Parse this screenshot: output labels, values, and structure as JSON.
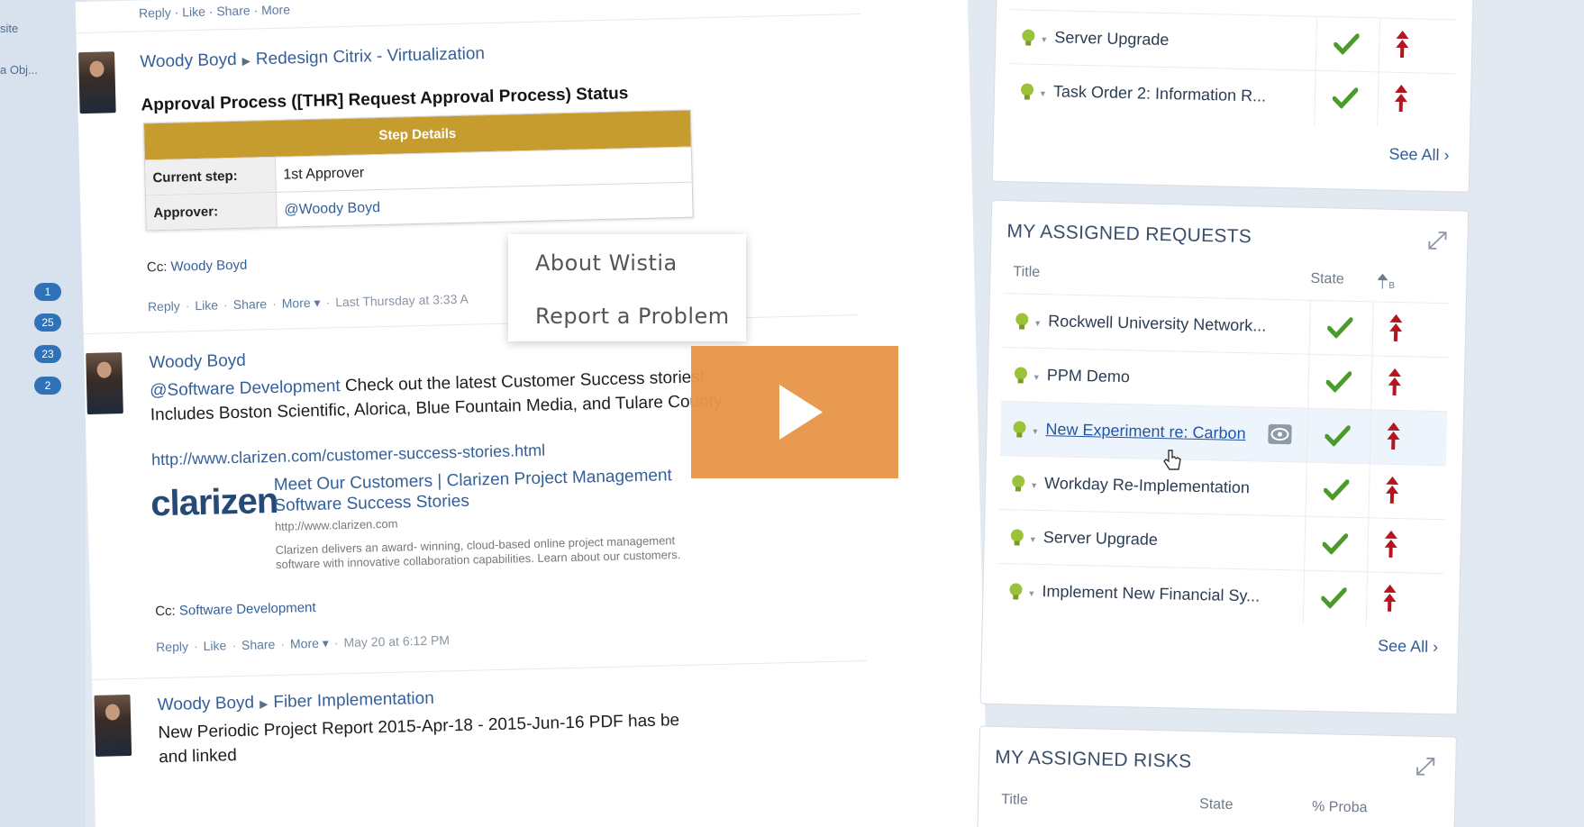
{
  "left_nav": {
    "items": [
      "site",
      "a Obj..."
    ],
    "badges": [
      "1",
      "25",
      "23",
      "2"
    ]
  },
  "feed": {
    "top_actions": "Reply · Like · Share · More",
    "post1": {
      "author": "Woody Boyd",
      "target": "Redesign Citrix - Virtualization",
      "approval_title": "Approval Process ([THR] Request Approval Process) Status",
      "step_details": "Step Details",
      "current_step_label": "Current step:",
      "current_step_value": "1st Approver",
      "approver_label": "Approver:",
      "approver_value": "@Woody Boyd",
      "cc_label": "Cc:",
      "cc_value": "Woody Boyd",
      "actions": {
        "reply": "Reply",
        "like": "Like",
        "share": "Share",
        "more": "More ▾",
        "timestamp": "Last Thursday at 3:33 A"
      }
    },
    "post2": {
      "author": "Woody Boyd",
      "mention": "@Software Development",
      "text1": "Check out the latest Customer Success stories!",
      "text2": "Includes Boston Scientific, Alorica, Blue Fountain Media, and Tulare County.",
      "link": "http://www.clarizen.com/customer-success-stories.html",
      "logo": "clarizen",
      "preview_title": "Meet Our Customers | Clarizen Project Management Software Success Stories",
      "preview_url": "http://www.clarizen.com",
      "preview_desc": "Clarizen delivers an award- winning, cloud-based online project management software with innovative collaboration capabilities. Learn about our customers.",
      "cc_label": "Cc:",
      "cc_value": "Software Development",
      "actions": {
        "reply": "Reply",
        "like": "Like",
        "share": "Share",
        "more": "More ▾",
        "timestamp": "May 20 at 6:12 PM"
      }
    },
    "post3": {
      "author": "Woody Boyd",
      "target": "Fiber Implementation",
      "text1": "New Periodic Project Report 2015-Apr-18 - 2015-Jun-16 PDF has be",
      "text2": "and linked"
    }
  },
  "sidebar": {
    "top_widget": {
      "rows": [
        "Server Upgrade",
        "Task Order 2: Information R..."
      ],
      "see_all": "See All ›"
    },
    "assigned_requests": {
      "title": "MY ASSIGNED REQUESTS",
      "col_title": "Title",
      "col_state": "State",
      "col_priority_icon": "priority-sort-icon",
      "rows": [
        "Rockwell University Network...",
        "PPM Demo",
        "New Experiment re: Carbon",
        "Workday Re-Implementation",
        "Server Upgrade",
        "Implement New Financial Sy..."
      ],
      "see_all": "See All ›"
    },
    "assigned_risks": {
      "title": "MY ASSIGNED RISKS",
      "col_title": "Title",
      "col_state": "State",
      "col_prob": "% Proba"
    }
  },
  "context_menu": {
    "items": [
      "About Wistia",
      "Report a Problem"
    ]
  },
  "colors": {
    "accent_gold": "#c69c2f",
    "play_orange": "#e7964a",
    "link_blue": "#335f9b",
    "check_green": "#4a9b2a",
    "priority_red": "#b3161f"
  }
}
